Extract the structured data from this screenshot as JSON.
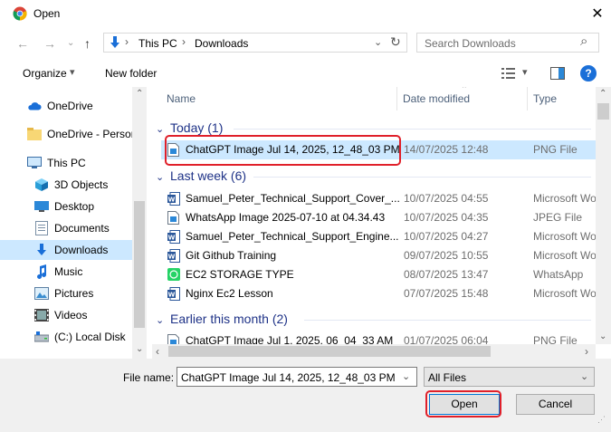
{
  "window": {
    "title": "Open",
    "close_glyph": "✕"
  },
  "nav": {
    "back": "←",
    "forward": "→",
    "up": "↑",
    "breadcrumb": [
      "This PC",
      "Downloads"
    ],
    "sep": "›",
    "dropdown": "⌄",
    "refresh": "↻",
    "search_placeholder": "Search Downloads",
    "search_icon": "⌕"
  },
  "toolbar": {
    "organize": "Organize",
    "organize_arrow": "▾",
    "new_folder": "New folder",
    "help": "?"
  },
  "sidebar": {
    "items": [
      {
        "label": "OneDrive",
        "icon": "cloud-icon"
      },
      {
        "label": "OneDrive - Persor",
        "icon": "folder-icon"
      },
      {
        "label": "This PC",
        "icon": "monitor-icon"
      },
      {
        "label": "3D Objects",
        "icon": "cube-icon"
      },
      {
        "label": "Desktop",
        "icon": "desktop-icon"
      },
      {
        "label": "Documents",
        "icon": "documents-icon"
      },
      {
        "label": "Downloads",
        "icon": "download-icon",
        "selected": true
      },
      {
        "label": "Music",
        "icon": "music-icon"
      },
      {
        "label": "Pictures",
        "icon": "pictures-icon"
      },
      {
        "label": "Videos",
        "icon": "videos-icon"
      },
      {
        "label": "(C:) Local Disk",
        "icon": "drive-icon"
      }
    ],
    "scroll_up": "⌃",
    "scroll_down": "⌄"
  },
  "columns": {
    "name": "Name",
    "date": "Date modified",
    "type": "Type",
    "sort_glyph": "⌃"
  },
  "groups": {
    "today": "Today (1)",
    "last_week": "Last week (6)",
    "earlier": "Earlier this month (2)",
    "chevron": "⌄"
  },
  "files": {
    "today": [
      {
        "name": "ChatGPT Image Jul 14, 2025, 12_48_03 PM",
        "date": "14/07/2025 12:48",
        "type": "PNG File",
        "icon": "image-file-icon"
      }
    ],
    "last_week": [
      {
        "name": "Samuel_Peter_Technical_Support_Cover_...",
        "date": "10/07/2025 04:55",
        "type": "Microsoft Wo",
        "icon": "word-icon"
      },
      {
        "name": "WhatsApp Image 2025-07-10 at 04.34.43",
        "date": "10/07/2025 04:35",
        "type": "JPEG File",
        "icon": "image-file-icon"
      },
      {
        "name": "Samuel_Peter_Technical_Support_Engine...",
        "date": "10/07/2025 04:27",
        "type": "Microsoft Wo",
        "icon": "word-icon"
      },
      {
        "name": "Git Github Training",
        "date": "09/07/2025 10:55",
        "type": "Microsoft Wo",
        "icon": "word-icon"
      },
      {
        "name": "EC2 STORAGE TYPE",
        "date": "08/07/2025 13:47",
        "type": "WhatsApp",
        "icon": "whatsapp-icon"
      },
      {
        "name": "Nginx Ec2 Lesson",
        "date": "07/07/2025 15:48",
        "type": "Microsoft Wo",
        "icon": "word-icon"
      }
    ],
    "earlier": [
      {
        "name": "ChatGPT Image Jul 1, 2025, 06_04_33 AM",
        "date": "01/07/2025 06:04",
        "type": "PNG File",
        "icon": "image-file-icon"
      }
    ]
  },
  "scroll": {
    "up": "⌃",
    "down": "⌄",
    "left": "‹",
    "right": "›"
  },
  "footer": {
    "file_name_label": "File name:",
    "file_name_value": "ChatGPT Image Jul 14, 2025, 12_48_03 PM",
    "filter_value": "All Files",
    "dropdown": "⌄",
    "open": "Open",
    "cancel": "Cancel"
  },
  "colors": {
    "accent": "#0078d7",
    "selection": "#cce8ff",
    "annotation": "#e0202a",
    "group_text": "#1e3287"
  }
}
